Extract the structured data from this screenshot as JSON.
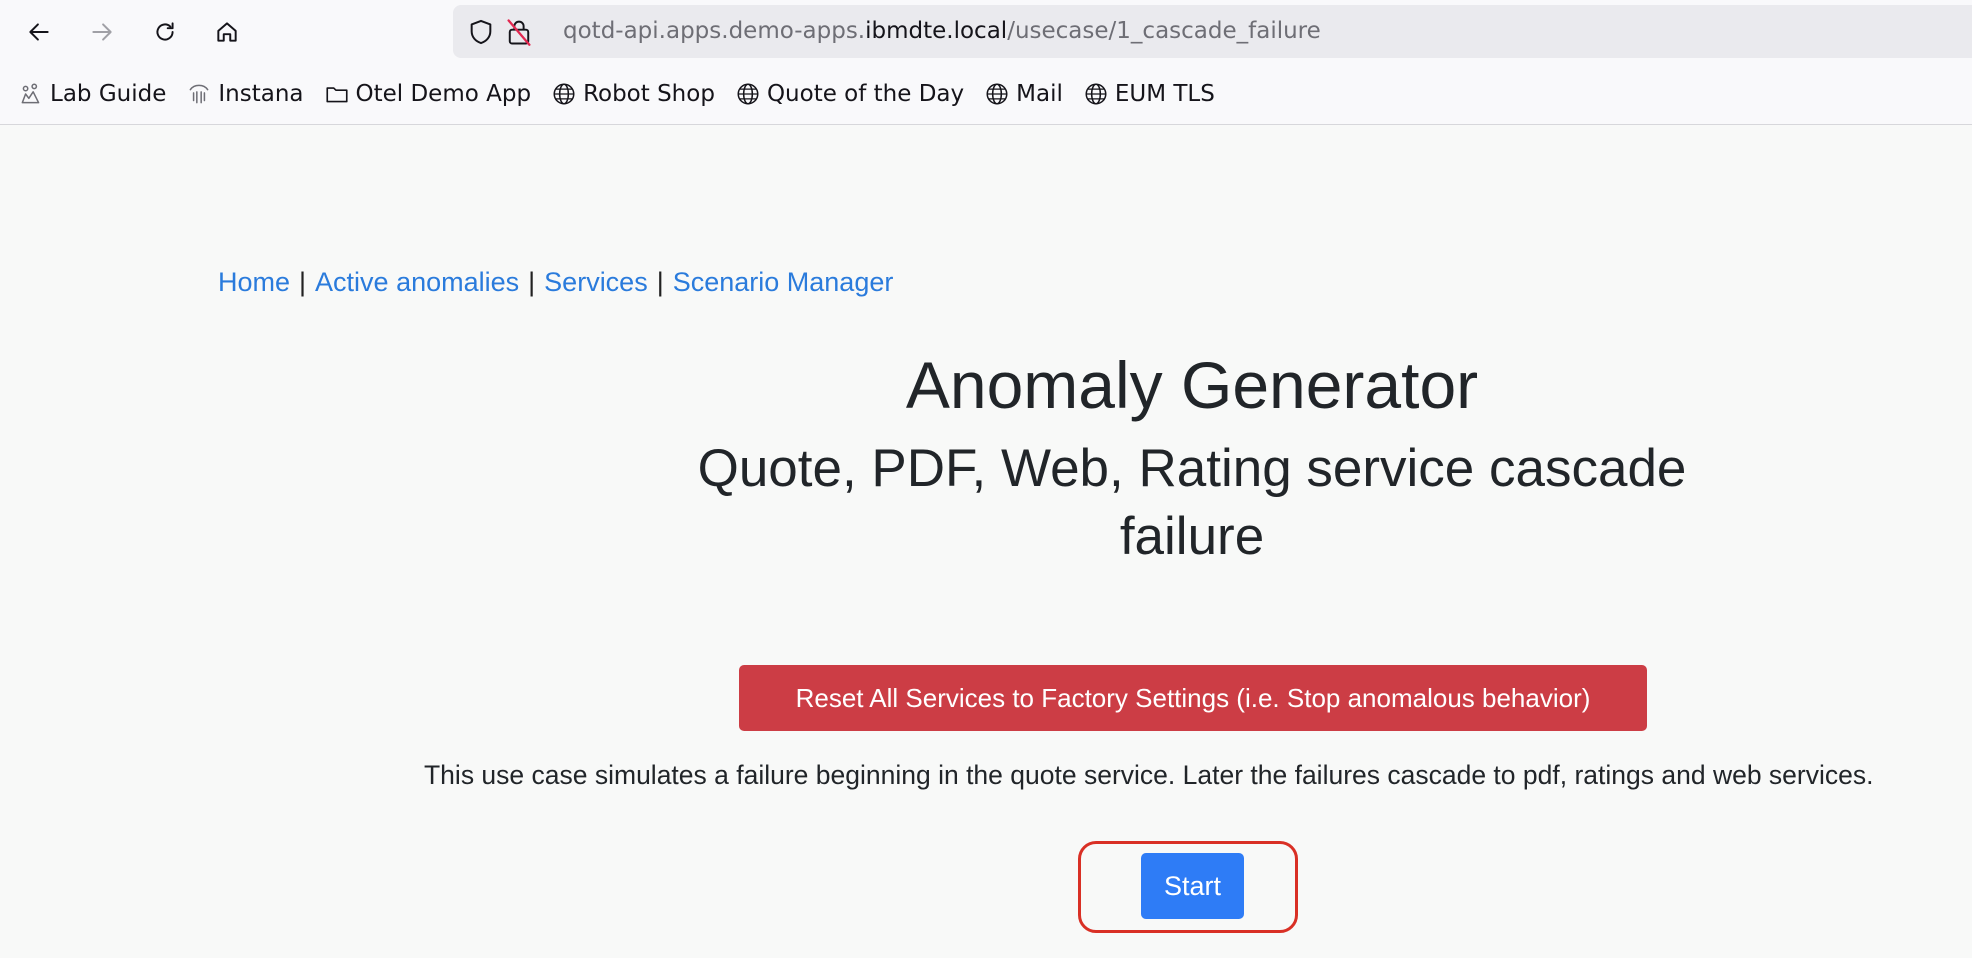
{
  "browser": {
    "url_prefix": "qotd-api.apps.demo-apps.",
    "url_domain": "ibmdte.local",
    "url_path": "/usecase/1_cascade_failure",
    "bookmarks": [
      {
        "label": "Lab Guide",
        "icon": "lab-guide-icon"
      },
      {
        "label": "Instana",
        "icon": "instana-icon"
      },
      {
        "label": "Otel Demo App",
        "icon": "folder-icon"
      },
      {
        "label": "Robot Shop",
        "icon": "globe-icon"
      },
      {
        "label": "Quote of the Day",
        "icon": "globe-icon"
      },
      {
        "label": "Mail",
        "icon": "globe-icon"
      },
      {
        "label": "EUM TLS",
        "icon": "globe-icon"
      }
    ]
  },
  "nav": {
    "home": "Home",
    "active_anomalies": "Active anomalies",
    "services": "Services",
    "scenario_manager": "Scenario Manager",
    "separator": "|"
  },
  "main": {
    "title": "Anomaly Generator",
    "subtitle_line1": "Quote, PDF, Web, Rating service cascade",
    "subtitle_line2": "failure",
    "reset_button": "Reset All Services to Factory Settings (i.e. Stop anomalous behavior)",
    "description": "This use case simulates a failure beginning in the quote service. Later the failures cascade to pdf, ratings and web services.",
    "start_button": "Start"
  },
  "colors": {
    "link": "#2a7bdc",
    "danger": "#cc3d45",
    "primary": "#2e7cf6",
    "highlight": "#d93025"
  }
}
